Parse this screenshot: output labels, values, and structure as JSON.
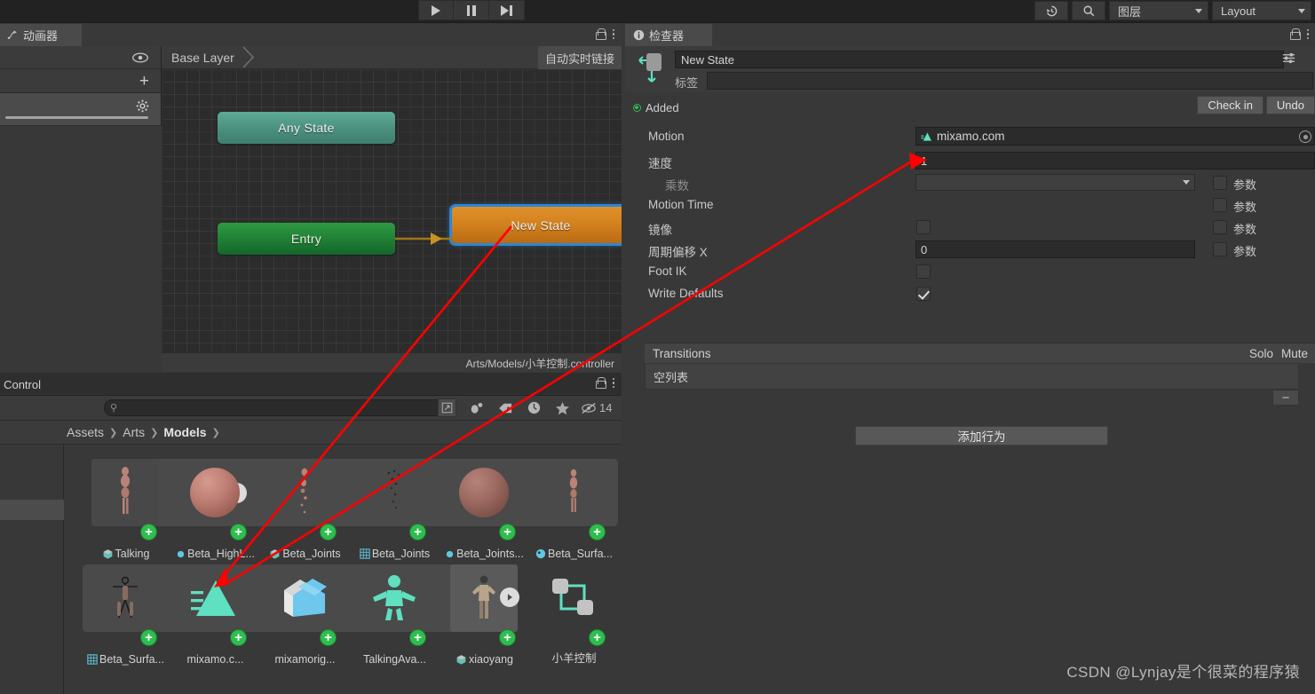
{
  "toolbar": {
    "play_label": "play-button",
    "pause_label": "pause-button",
    "step_label": "step-button",
    "history_icon": "history-icon",
    "search_icon": "search-icon",
    "layers_dropdown": "图层",
    "layout_dropdown": "Layout"
  },
  "animator": {
    "tab_label": "动画器",
    "layer_name": "Base Layer",
    "auto_live_link": "自动实时链接",
    "nodes": [
      {
        "label": "Any State",
        "type": "any-state"
      },
      {
        "label": "Entry",
        "type": "entry-state"
      },
      {
        "label": "New State",
        "type": "new-state",
        "selected": true
      }
    ],
    "footer_path": "Arts/Models/小羊控制.controller"
  },
  "project": {
    "tab_label": "on Control",
    "search_placeholder": "",
    "search_value": "",
    "hidden_count": "14",
    "breadcrumb": [
      "Assets",
      "Arts",
      "Models"
    ],
    "assets_row1": [
      {
        "name": "Talking",
        "icon": "prefab-icon"
      },
      {
        "name": "Beta_HighL...",
        "icon": "material-icon"
      },
      {
        "name": "Beta_Joints",
        "icon": "prefab-icon"
      },
      {
        "name": "Beta_Joints",
        "icon": "mesh-icon"
      },
      {
        "name": "Beta_Joints...",
        "icon": "material-icon"
      },
      {
        "name": "Beta_Surfa...",
        "icon": "avatar-icon"
      }
    ],
    "assets_row2": [
      {
        "name": "Beta_Surfa...",
        "icon": "mesh-icon"
      },
      {
        "name": "mixamo.c...",
        "icon": "animation-clip-icon"
      },
      {
        "name": "mixamorig...",
        "icon": "avatar-mask-icon"
      },
      {
        "name": "TalkingAva...",
        "icon": "avatar-icon"
      },
      {
        "name": "xiaoyang",
        "icon": "prefab-icon"
      },
      {
        "name": "小羊控制",
        "icon": "animator-controller-icon"
      }
    ]
  },
  "inspector": {
    "tab_label": "检查器",
    "object_name": "New State",
    "tag_label": "标签",
    "tag_value": "",
    "version_status": "Added",
    "check_in_label": "Check in",
    "undo_label": "Undo",
    "properties": [
      {
        "label": "Motion",
        "value": "mixamo.com",
        "kind": "object"
      },
      {
        "label": "速度",
        "value": "1",
        "kind": "number"
      },
      {
        "label": "乘数",
        "value": "",
        "kind": "dropdown",
        "dim": true,
        "param": "参数"
      },
      {
        "label": "Motion Time",
        "value": "",
        "kind": "none",
        "param": "参数"
      },
      {
        "label": "镜像",
        "value": "",
        "kind": "checkbox",
        "checked": false,
        "param": "参数"
      },
      {
        "label": "周期偏移 X",
        "value": "0",
        "kind": "number",
        "param": "参数"
      },
      {
        "label": "Foot IK",
        "value": "",
        "kind": "checkbox",
        "checked": false
      },
      {
        "label": "Write Defaults",
        "value": "",
        "kind": "checkbox",
        "checked": true
      }
    ],
    "transitions_header": "Transitions",
    "transitions_solo": "Solo",
    "transitions_mute": "Mute",
    "transitions_empty": "空列表",
    "minus_label": "−",
    "add_behaviour_label": "添加行为"
  },
  "watermark": "CSDN @Lynjay是个很菜的程序猿",
  "colors": {
    "accent_select": "#2c86d8",
    "state_orange": "#d4821f",
    "any_state_teal": "#4a8f7e",
    "entry_green": "#1f7e33",
    "annotation_red": "#ff0000",
    "badge_green": "#2fbd4e"
  }
}
